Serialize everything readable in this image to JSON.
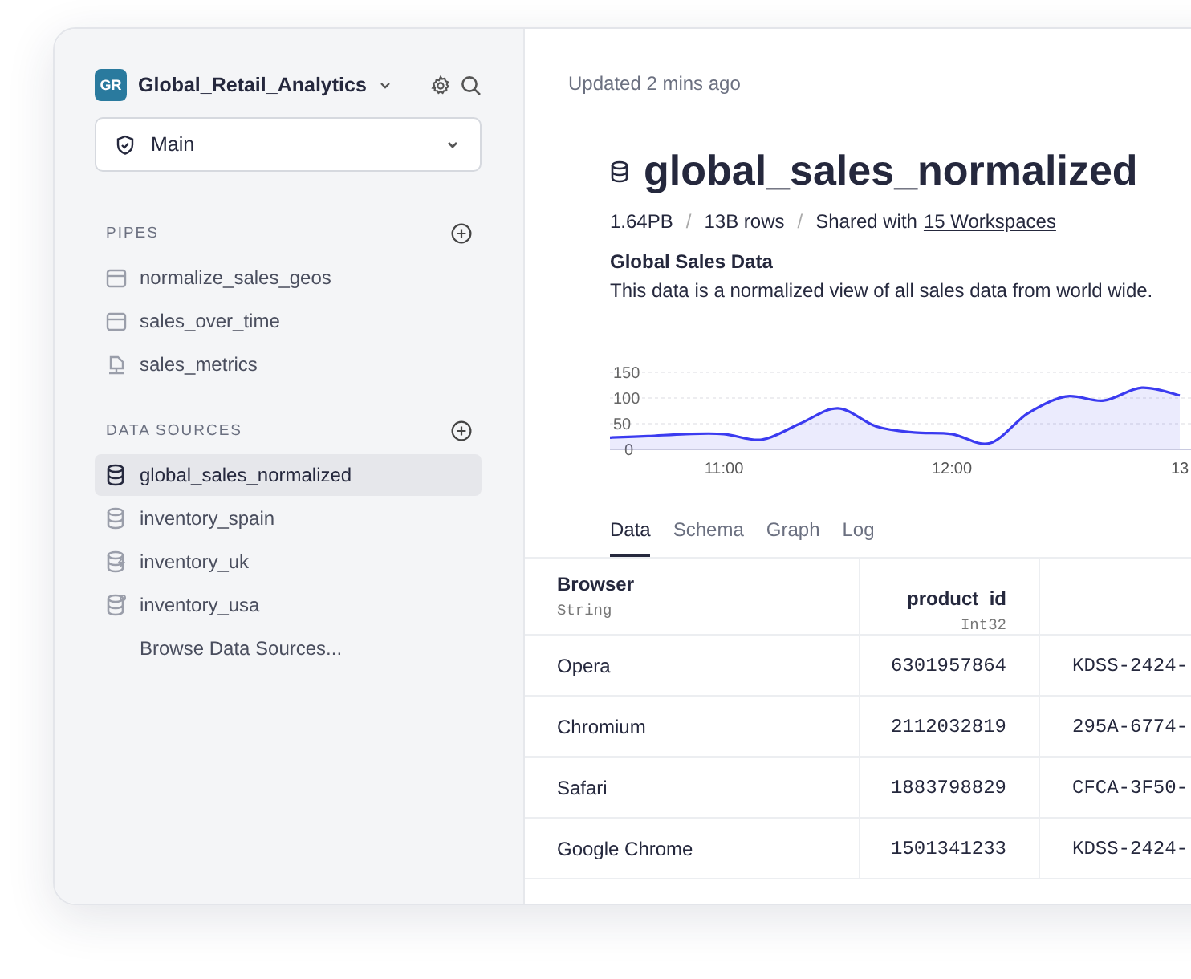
{
  "workspace": {
    "initials": "GR",
    "name": "Global_Retail_Analytics"
  },
  "branch": {
    "value": "Main"
  },
  "sidebar": {
    "sections": [
      {
        "title": "PIPES",
        "items": [
          {
            "label": "normalize_sales_geos",
            "kind": "pipe",
            "selected": false
          },
          {
            "label": "sales_over_time",
            "kind": "pipe",
            "selected": false
          },
          {
            "label": "sales_metrics",
            "kind": "endpoint",
            "selected": false
          }
        ]
      },
      {
        "title": "DATA SOURCES",
        "items": [
          {
            "label": "global_sales_normalized",
            "kind": "datasource",
            "selected": true
          },
          {
            "label": "inventory_spain",
            "kind": "datasource",
            "selected": false
          },
          {
            "label": "inventory_uk",
            "kind": "stream",
            "selected": false
          },
          {
            "label": "inventory_usa",
            "kind": "linked",
            "selected": false
          },
          {
            "label": "Browse Data Sources...",
            "kind": "link",
            "selected": false
          }
        ]
      }
    ]
  },
  "updated": "Updated 2 mins ago",
  "title": "global_sales_normalized",
  "meta": {
    "size": "1.64PB",
    "separator_1": "/",
    "rows": "13B rows",
    "separator_2": "/",
    "shared_prefix": "Shared with",
    "shared_link": "15 Workspaces"
  },
  "description": {
    "heading": "Global Sales Data",
    "text": "This data is a normalized view of all sales data from world wide."
  },
  "chart_data": {
    "type": "area",
    "categories": [
      null,
      null,
      null,
      "11:00",
      null,
      null,
      null,
      null,
      null,
      "12:00",
      null,
      null,
      null,
      null,
      null,
      "13"
    ],
    "series": [
      {
        "color": "#3b3bf0",
        "values": [
          23,
          26,
          30,
          30,
          19,
          50,
          80,
          45,
          33,
          30,
          12,
          70,
          103,
          95,
          120,
          105
        ]
      }
    ],
    "ylim": [
      0,
      150
    ],
    "yticks": [
      0,
      50,
      100,
      150
    ]
  },
  "tabs": [
    {
      "label": "Data",
      "selected": true
    },
    {
      "label": "Schema",
      "selected": false
    },
    {
      "label": "Graph",
      "selected": false
    },
    {
      "label": "Log",
      "selected": false
    }
  ],
  "table": {
    "columns": [
      {
        "name": "Browser",
        "type": "String"
      },
      {
        "name": "product_id",
        "type": "Int32"
      }
    ],
    "rows": [
      [
        "Opera",
        "6301957864",
        "KDSS-2424-"
      ],
      [
        "Chromium",
        "2112032819",
        "295A-6774-"
      ],
      [
        "Safari",
        "1883798829",
        "CFCA-3F50-"
      ],
      [
        "Google Chrome",
        "1501341233",
        "KDSS-2424-"
      ]
    ]
  }
}
